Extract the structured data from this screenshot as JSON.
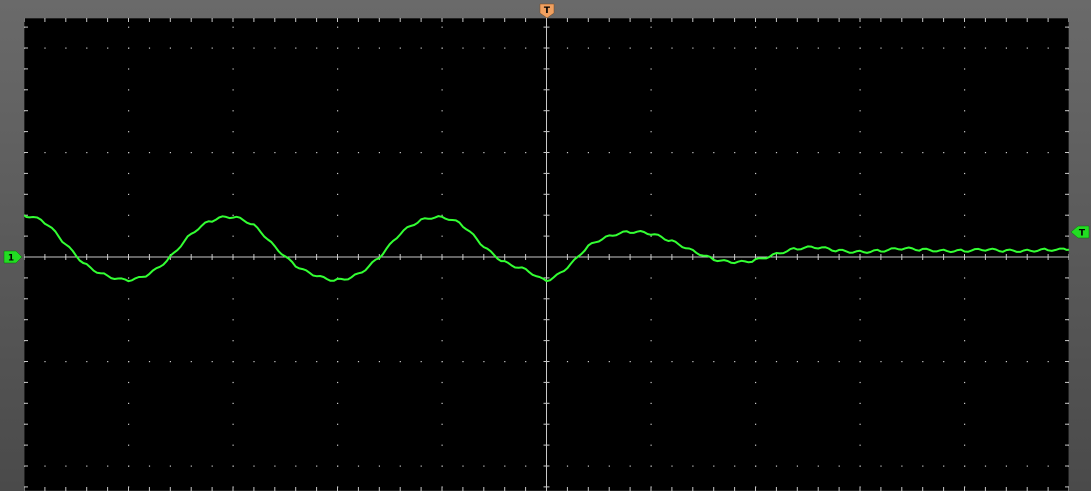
{
  "trigger_marker": {
    "label": "T",
    "color": "#f0a060"
  },
  "channel_marker": {
    "label": "1",
    "color": "#22dd22"
  },
  "trigger_level_marker": {
    "label": "T",
    "color": "#22dd22"
  },
  "colors": {
    "background": "#000000",
    "grid": "#c8c8c8",
    "trace": "#33ff33",
    "frame": "#5a5a5a"
  },
  "chart_data": {
    "type": "line",
    "title": "",
    "xlabel": "",
    "ylabel": "",
    "grid": true,
    "divisions": {
      "x": 10,
      "y": 8
    },
    "xlim": [
      -5,
      5
    ],
    "ylim": [
      -4,
      4
    ],
    "trigger_level_div": 0.4,
    "series": [
      {
        "points": [
          [
            -5.0,
            0.4
          ],
          [
            -4.8,
            0.33
          ],
          [
            -4.6,
            0.12
          ],
          [
            -4.4,
            -0.08
          ],
          [
            -4.2,
            -0.18
          ],
          [
            -4.0,
            -0.22
          ],
          [
            -3.8,
            -0.16
          ],
          [
            -3.6,
            0.0
          ],
          [
            -3.4,
            0.22
          ],
          [
            -3.2,
            0.35
          ],
          [
            -3.0,
            0.38
          ],
          [
            -2.8,
            0.3
          ],
          [
            -2.6,
            0.1
          ],
          [
            -2.4,
            -0.08
          ],
          [
            -2.2,
            -0.18
          ],
          [
            -2.0,
            -0.22
          ],
          [
            -1.8,
            -0.16
          ],
          [
            -1.6,
            0.0
          ],
          [
            -1.4,
            0.22
          ],
          [
            -1.2,
            0.35
          ],
          [
            -1.0,
            0.38
          ],
          [
            -0.8,
            0.3
          ],
          [
            -0.6,
            0.1
          ],
          [
            -0.4,
            -0.05
          ],
          [
            -0.2,
            -0.12
          ],
          [
            0.0,
            -0.22
          ],
          [
            0.2,
            -0.1
          ],
          [
            0.4,
            0.1
          ],
          [
            0.6,
            0.2
          ],
          [
            0.8,
            0.24
          ],
          [
            1.0,
            0.22
          ],
          [
            1.2,
            0.15
          ],
          [
            1.4,
            0.06
          ],
          [
            1.6,
            -0.02
          ],
          [
            1.8,
            -0.05
          ],
          [
            2.0,
            -0.03
          ],
          [
            2.2,
            0.03
          ],
          [
            2.4,
            0.08
          ],
          [
            2.6,
            0.09
          ],
          [
            2.8,
            0.06
          ],
          [
            3.0,
            0.05
          ],
          [
            3.2,
            0.06
          ],
          [
            3.4,
            0.08
          ],
          [
            3.6,
            0.07
          ],
          [
            3.8,
            0.06
          ],
          [
            4.0,
            0.06
          ],
          [
            4.2,
            0.07
          ],
          [
            4.4,
            0.06
          ],
          [
            4.6,
            0.06
          ],
          [
            4.8,
            0.07
          ],
          [
            5.0,
            0.07
          ]
        ]
      }
    ]
  }
}
